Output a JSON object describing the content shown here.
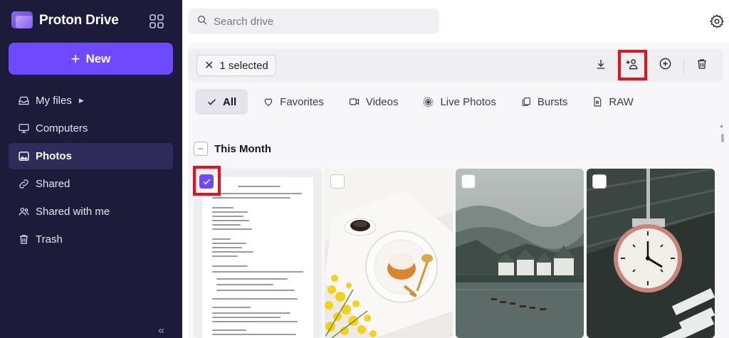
{
  "app": {
    "brand": "Proton Drive",
    "new_label": "New",
    "nav": [
      {
        "label": "My files",
        "icon": "inbox-icon",
        "has_caret": true
      },
      {
        "label": "Computers",
        "icon": "monitor-icon"
      },
      {
        "label": "Photos",
        "icon": "image-icon",
        "active": true
      },
      {
        "label": "Shared",
        "icon": "link-icon"
      },
      {
        "label": "Shared with me",
        "icon": "users-icon"
      },
      {
        "label": "Trash",
        "icon": "trash-icon"
      }
    ],
    "collapse_glyph": "«"
  },
  "search": {
    "placeholder": "Search drive"
  },
  "toolbar": {
    "selection_label": "1 selected",
    "actions": [
      "download-icon",
      "share-add-user-icon",
      "add-to-album-icon",
      "trash-icon"
    ]
  },
  "filters": [
    {
      "label": "All",
      "active": true,
      "icon": "check-icon"
    },
    {
      "label": "Favorites",
      "icon": "heart-icon"
    },
    {
      "label": "Videos",
      "icon": "video-icon"
    },
    {
      "label": "Live Photos",
      "icon": "live-photo-icon"
    },
    {
      "label": "Bursts",
      "icon": "bursts-icon"
    },
    {
      "label": "RAW",
      "icon": "raw-icon"
    }
  ],
  "section": {
    "title": "This Month"
  },
  "tiles": [
    {
      "kind": "document",
      "selected": true
    },
    {
      "kind": "coffee-flowers",
      "selected": false
    },
    {
      "kind": "misty-lake",
      "selected": false
    },
    {
      "kind": "station-clock",
      "selected": false
    }
  ],
  "colors": {
    "sidebar_bg": "#1c1b3a",
    "accent": "#6d4aff",
    "highlight": "#e8101e"
  }
}
